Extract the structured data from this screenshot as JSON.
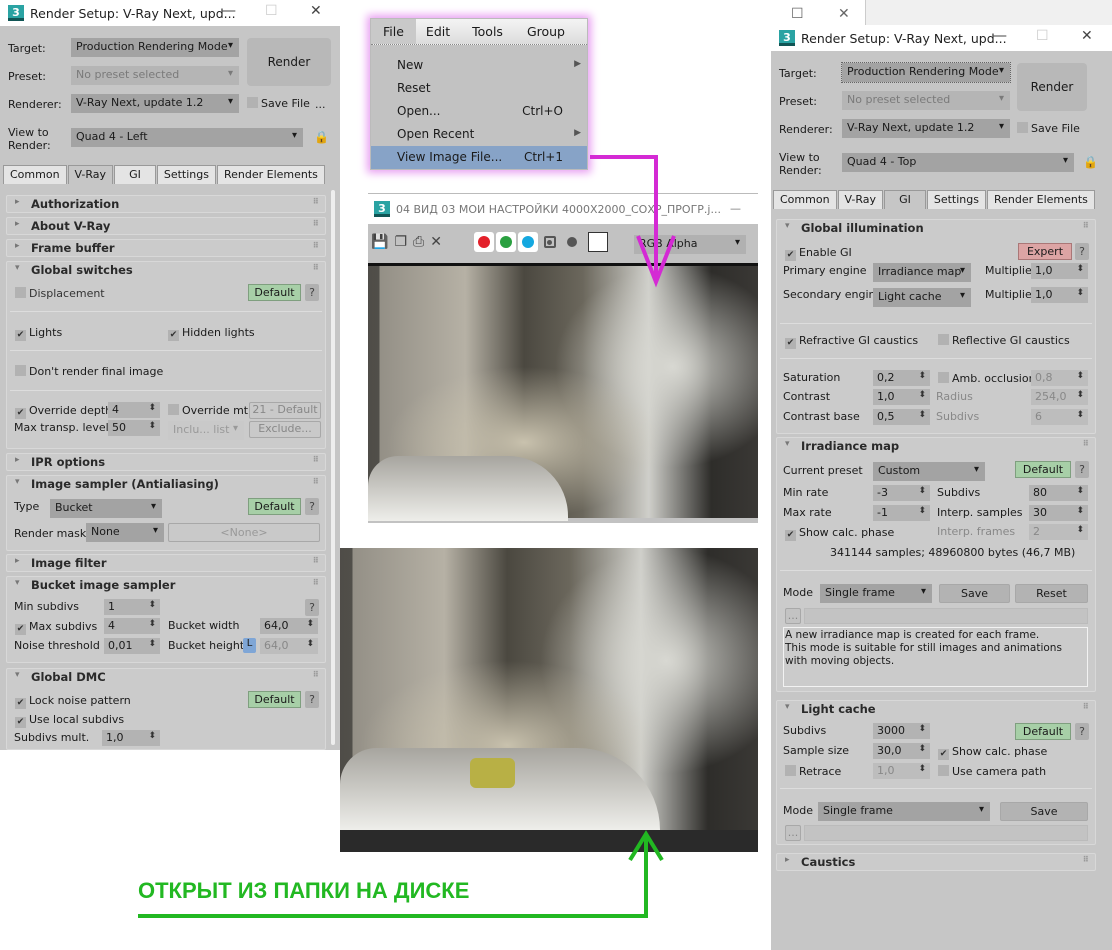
{
  "left": {
    "title": "Render Setup: V-Ray Next, upd...",
    "target_label": "Target:",
    "target": "Production Rendering Mode",
    "preset_label": "Preset:",
    "preset": "No preset selected",
    "renderer_label": "Renderer:",
    "renderer": "V-Ray Next, update 1.2",
    "save_file": "Save File",
    "more": "...",
    "view_label": "View to Render:",
    "view": "Quad 4 - Left",
    "render": "Render",
    "tabs": [
      "Common",
      "V-Ray",
      "GI",
      "Settings",
      "Render Elements"
    ],
    "rollouts": {
      "auth": "Authorization",
      "about": "About V-Ray",
      "fb": "Frame buffer",
      "gs": "Global switches",
      "ipr": "IPR options",
      "is": "Image sampler (Antialiasing)",
      "if": "Image filter",
      "bis": "Bucket image sampler",
      "dmc": "Global DMC"
    },
    "gs": {
      "displacement": "Displacement",
      "default": "Default",
      "q": "?",
      "lights": "Lights",
      "hidden_lights": "Hidden lights",
      "dont_render": "Don't render final image",
      "override_depth": "Override depth",
      "override_depth_val": "4",
      "override_mtl": "Override mtl",
      "mtl": "21 - Default",
      "max_transp": "Max transp. levels",
      "max_transp_val": "50",
      "include_list": "Inclu... list",
      "exclude": "Exclude..."
    },
    "is": {
      "type_label": "Type",
      "type": "Bucket",
      "default": "Default",
      "mask_label": "Render mask",
      "mask": "None",
      "mask_obj": "<None>"
    },
    "bis": {
      "min_label": "Min subdivs",
      "min": "1",
      "max_label": "Max subdivs",
      "max": "4",
      "noise_label": "Noise threshold",
      "noise": "0,01",
      "bw_label": "Bucket width",
      "bw": "64,0",
      "bh_label": "Bucket height",
      "lock": "L",
      "bh": "64,0"
    },
    "dmc": {
      "lock": "Lock noise pattern",
      "default": "Default",
      "local": "Use local subdivs",
      "mult_label": "Subdivs mult.",
      "mult": "1,0"
    }
  },
  "menu": {
    "bar": [
      "File",
      "Edit",
      "Tools",
      "Group"
    ],
    "items": [
      {
        "label": "New",
        "shortcut": ""
      },
      {
        "label": "Reset",
        "shortcut": ""
      },
      {
        "label": "Open...",
        "shortcut": "Ctrl+O"
      },
      {
        "label": "Open Recent",
        "shortcut": ""
      },
      {
        "label": "View Image File...",
        "shortcut": "Ctrl+1"
      }
    ]
  },
  "viewer": {
    "title": "04 ВИД 03 МОИ НАСТРОЙКИ 4000X2000_СОХР_ПРОГР.j...",
    "channel": "RGB Alpha",
    "min": "—"
  },
  "right": {
    "title": "Render Setup: V-Ray Next, upd...",
    "target_label": "Target:",
    "target": "Production Rendering Mode",
    "preset_label": "Preset:",
    "preset": "No preset selected",
    "renderer_label": "Renderer:",
    "renderer": "V-Ray Next, update 1.2",
    "save_file": "Save File",
    "view_label": "View to Render:",
    "view": "Quad 4 - Top",
    "render": "Render",
    "tabs": [
      "Common",
      "V-Ray",
      "GI",
      "Settings",
      "Render Elements"
    ],
    "gi": {
      "head": "Global illumination",
      "enable": "Enable GI",
      "expert": "Expert",
      "q": "?",
      "primary_label": "Primary engine",
      "primary": "Irradiance map",
      "mult_label": "Multiplier",
      "mult1": "1,0",
      "secondary_label": "Secondary engine",
      "secondary": "Light cache",
      "mult2": "1,0",
      "refr": "Refractive GI caustics",
      "refl": "Reflective GI caustics",
      "sat_label": "Saturation",
      "sat": "0,2",
      "amb": "Amb. occlusion",
      "amb_val": "0,8",
      "con_label": "Contrast",
      "con": "1,0",
      "radius_label": "Radius",
      "radius": "254,0",
      "cb_label": "Contrast base",
      "cb": "0,5",
      "subdivs_label": "Subdivs",
      "subdivs": "6"
    },
    "im": {
      "head": "Irradiance map",
      "preset_label": "Current preset",
      "preset": "Custom",
      "default": "Default",
      "min_label": "Min rate",
      "min": "-3",
      "subdivs_label": "Subdivs",
      "subdivs": "80",
      "max_label": "Max rate",
      "max": "-1",
      "interp_label": "Interp. samples",
      "interp": "30",
      "show": "Show calc. phase",
      "frames_label": "Interp. frames",
      "frames": "2",
      "stats": "341144 samples; 48960800 bytes (46,7 MB)",
      "mode_label": "Mode",
      "mode": "Single frame",
      "save": "Save",
      "reset": "Reset",
      "dots": "...",
      "desc": "A new irradiance map is created for each frame.\nThis mode is suitable for still images and animations with moving objects."
    },
    "lc": {
      "head": "Light cache",
      "subdivs_label": "Subdivs",
      "subdivs": "3000",
      "default": "Default",
      "size_label": "Sample size",
      "size": "30,0",
      "show": "Show calc. phase",
      "retrace": "Retrace",
      "retrace_val": "1,0",
      "camera": "Use camera path",
      "mode_label": "Mode",
      "mode": "Single frame",
      "save": "Save",
      "dots": "..."
    },
    "caustics": "Caustics"
  },
  "caption": "ОТКРЫТ ИЗ ПАПКИ НА ДИСКЕ",
  "colors": {
    "arrow_magenta": "#d42ad4",
    "arrow_green": "#22b822"
  }
}
